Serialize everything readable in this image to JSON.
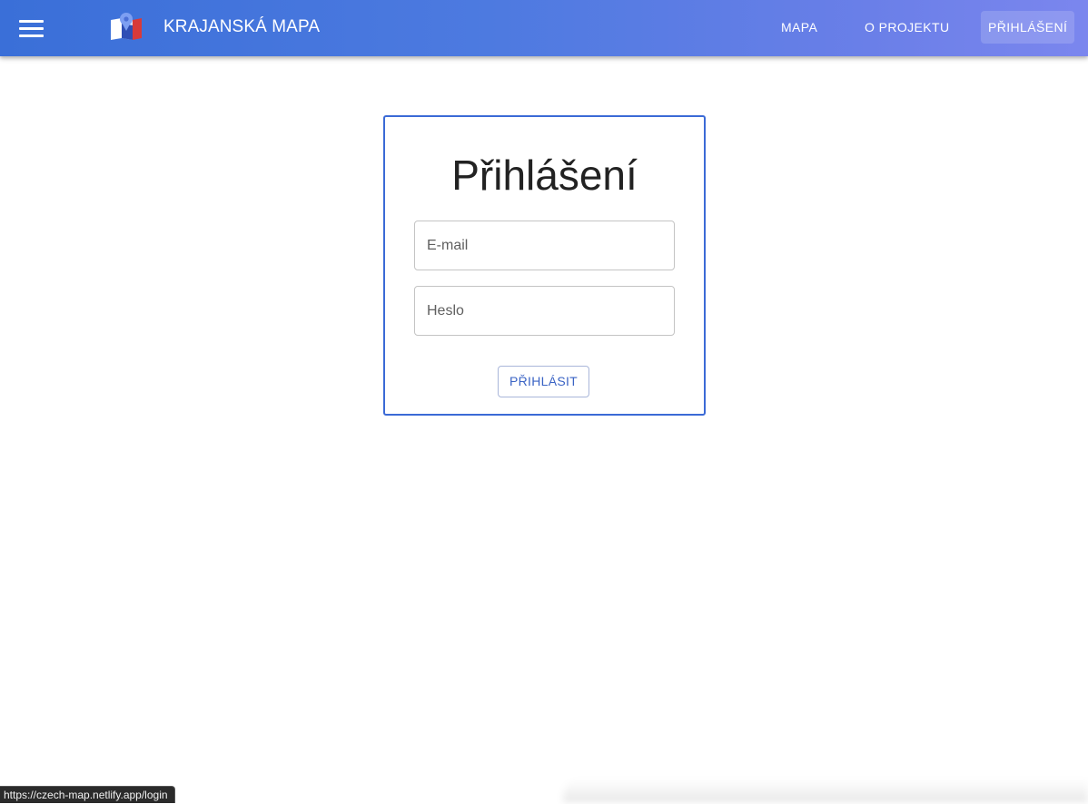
{
  "appbar": {
    "title": "KRAJANSKÁ MAPA",
    "menu_icon": "hamburger-menu-icon",
    "logo_icon": "czech-map-pin-logo",
    "nav": [
      {
        "label": "MAPA"
      },
      {
        "label": "O PROJEKTU"
      },
      {
        "label": "PŘIHLÁŠENÍ",
        "active": true
      }
    ],
    "colors": {
      "gradient_start": "#3a6fd8",
      "gradient_end": "#7b86ee"
    }
  },
  "login": {
    "title": "Přihlášení",
    "email_placeholder": "E-mail",
    "email_value": "",
    "password_placeholder": "Heslo",
    "password_value": "",
    "submit_label": "PŘIHLÁSIT",
    "accent_color": "#3b6ad6"
  },
  "status_bar": {
    "url": "https://czech-map.netlify.app/login"
  }
}
